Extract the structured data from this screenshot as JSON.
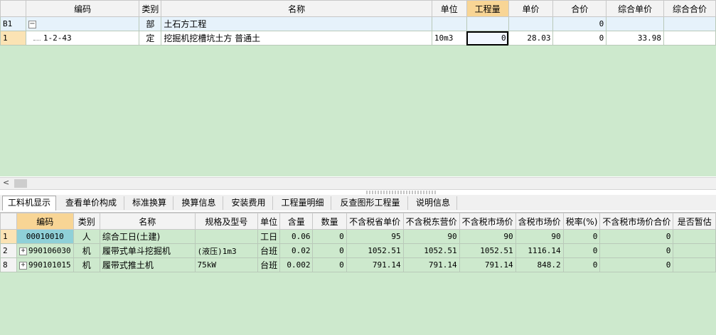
{
  "top_table": {
    "headers": [
      "",
      "编码",
      "类别",
      "名称",
      "单位",
      "工程量",
      "单价",
      "合价",
      "综合单价",
      "综合合价"
    ],
    "rows": [
      {
        "no": "B1",
        "code": "",
        "type": "部",
        "name": "土石方工程",
        "unit": "",
        "qty": "",
        "price": "",
        "total": "0",
        "comp_price": "",
        "comp_total": ""
      },
      {
        "no": "1",
        "code": "1-2-43",
        "type": "定",
        "name": "挖掘机挖槽坑土方 普通土",
        "unit": "10m3",
        "qty": "0",
        "price": "28.03",
        "total": "0",
        "comp_price": "33.98",
        "comp_total": ""
      }
    ],
    "expander_symbol": "−"
  },
  "scroll": {
    "left_arrow": "<"
  },
  "tabs": [
    "工料机显示",
    "查看单价构成",
    "标准换算",
    "换算信息",
    "安装费用",
    "工程量明细",
    "反查图形工程量",
    "说明信息"
  ],
  "bottom_table": {
    "headers": [
      "",
      "编码",
      "类别",
      "名称",
      "规格及型号",
      "单位",
      "含量",
      "数量",
      "不含税省单价",
      "不含税东营价",
      "不含税市场价",
      "含税市场价",
      "税率(%)",
      "不含税市场价合价",
      "是否暂估"
    ],
    "rows": [
      {
        "no": "1",
        "expand": "",
        "code": "00010010",
        "type": "人",
        "name": "综合工日(土建)",
        "spec": "",
        "unit": "工日",
        "content": "0.06",
        "qty": "0",
        "prov_price": "95",
        "dy_price": "90",
        "market_price": "90",
        "tax_market": "90",
        "tax_rate": "0",
        "market_total": "0",
        "provisional": ""
      },
      {
        "no": "2",
        "expand": "+",
        "code": "990106030",
        "type": "机",
        "name": "履带式单斗挖掘机",
        "spec": "(液压)1m3",
        "unit": "台班",
        "content": "0.02",
        "qty": "0",
        "prov_price": "1052.51",
        "dy_price": "1052.51",
        "market_price": "1052.51",
        "tax_market": "1116.14",
        "tax_rate": "0",
        "market_total": "0",
        "provisional": ""
      },
      {
        "no": "8",
        "expand": "+",
        "code": "990101015",
        "type": "机",
        "name": "履带式推土机",
        "spec": "75kW",
        "unit": "台班",
        "content": "0.002",
        "qty": "0",
        "prov_price": "791.14",
        "dy_price": "791.14",
        "market_price": "791.14",
        "tax_market": "848.2",
        "tax_rate": "0",
        "market_total": "0",
        "provisional": ""
      }
    ]
  }
}
